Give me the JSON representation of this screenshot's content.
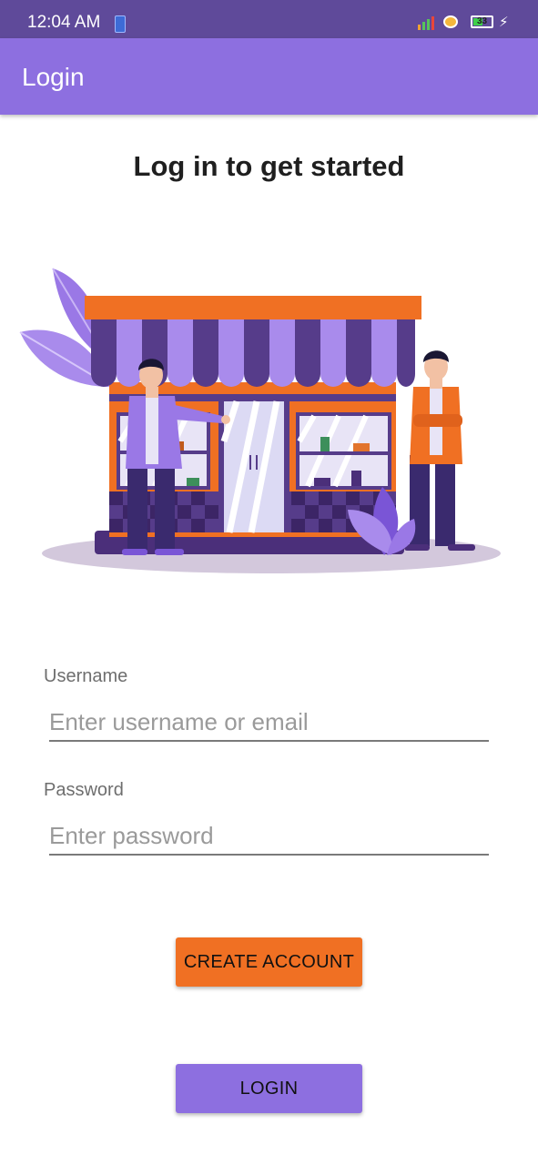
{
  "status_bar": {
    "time": "12:04 AM",
    "battery": "33"
  },
  "app_bar": {
    "title": "Login"
  },
  "heading": "Log in to get started",
  "form": {
    "username": {
      "label": "Username",
      "value": "",
      "placeholder": "Enter username or email"
    },
    "password": {
      "label": "Password",
      "value": "",
      "placeholder": "Enter password"
    }
  },
  "buttons": {
    "create_account": "CREATE ACCOUNT",
    "login": "LOGIN"
  },
  "icons": {
    "notification": "phone-notification-icon",
    "signal": "signal-bars-icon",
    "vpn": "vpn-icon",
    "battery": "battery-icon",
    "charging": "lightning-bolt-icon"
  },
  "colors": {
    "status_bar": "#5f4a9a",
    "app_bar": "#8d6fe0",
    "create_button": "#f07023",
    "login_button": "#8d6fe0"
  }
}
